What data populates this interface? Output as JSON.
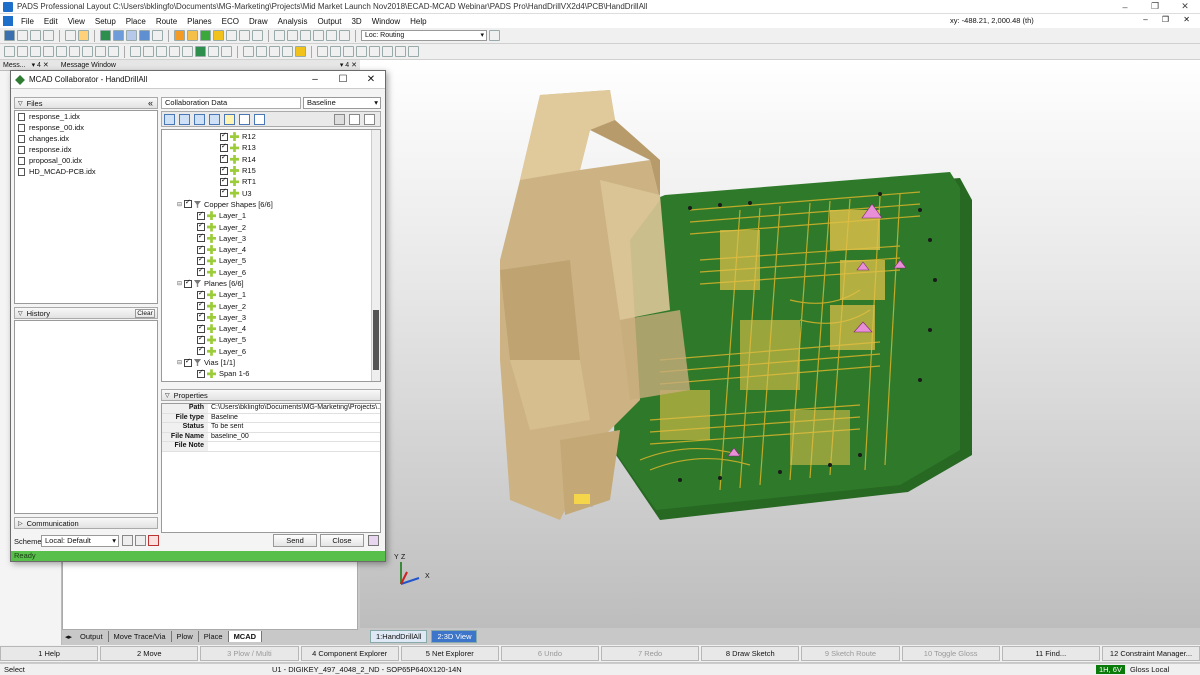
{
  "window": {
    "title": "PADS Professional Layout  C:\\Users\\bklingfo\\Documents\\MG-Marketing\\Projects\\Mid Market Launch Nov2018\\ECAD-MCAD Webinar\\PADS Pro\\HandDrillVX2d4\\PCB\\HandDrillAll",
    "minimize": "–",
    "maximize": "❐",
    "close": "✕"
  },
  "menu": {
    "items": [
      "File",
      "Edit",
      "View",
      "Setup",
      "Place",
      "Route",
      "Planes",
      "ECO",
      "Draw",
      "Analysis",
      "Output",
      "3D",
      "Window",
      "Help"
    ],
    "coords": "xy: -488.21, 2,000.48 (th)",
    "mdi_controls": "– ❐ ✕"
  },
  "toolbar": {
    "loc": "Loc: Routing"
  },
  "message_bar": {
    "left_tab": "Mess...",
    "pin": "▾ 4 ✕",
    "right_tab": "Message Window",
    "right_pin": "▾ 4 ✕"
  },
  "dialog": {
    "title": "MCAD Collaborator - HandDrillAll",
    "minimize": "–",
    "maximize": "☐",
    "close": "✕",
    "files": {
      "header": "Files",
      "collapse": "«",
      "items": [
        "response_1.idx",
        "response_00.idx",
        "changes.idx",
        "response.idx",
        "proposal_00.idx",
        "HD_MCAD-PCB.idx"
      ]
    },
    "history": {
      "header": "History",
      "clear": "Clear"
    },
    "communication": {
      "header": "Communication"
    },
    "collab": {
      "label": "Collaboration Data",
      "select": "Baseline"
    },
    "tree": {
      "refdes": [
        "R12",
        "R13",
        "R14",
        "R15",
        "RT1",
        "U3"
      ],
      "copper": {
        "label": "Copper Shapes [6/6]",
        "layers": [
          "Layer_1",
          "Layer_2",
          "Layer_3",
          "Layer_4",
          "Layer_5",
          "Layer_6"
        ]
      },
      "planes": {
        "label": "Planes [6/6]",
        "layers": [
          "Layer_1",
          "Layer_2",
          "Layer_3",
          "Layer_4",
          "Layer_5",
          "Layer_6"
        ]
      },
      "vias": {
        "label": "Vias [1/1]",
        "items": [
          "Span 1-6"
        ]
      }
    },
    "properties": {
      "header": "Properties",
      "rows": [
        {
          "key": "Path",
          "value": "C:\\Users\\bklingfo\\Documents\\MG-Marketing\\Projects\\..."
        },
        {
          "key": "File type",
          "value": "Baseline"
        },
        {
          "key": "Status",
          "value": "To be sent"
        },
        {
          "key": "File Name",
          "value": "baseline_00"
        },
        {
          "key": "File Note",
          "value": ""
        }
      ]
    },
    "scheme": {
      "label": "Scheme:",
      "value": "Local: Default"
    },
    "send": "Send",
    "close_btn": "Close",
    "status": "Ready"
  },
  "bottom_tabs": [
    "Output",
    "Move Trace/Via",
    "Plow",
    "Place",
    "MCAD"
  ],
  "view_tabs": [
    "1:HandDrillAll",
    "2:3D View"
  ],
  "axes": {
    "x": "X",
    "y": "Y",
    "z": "Z"
  },
  "function_keys": [
    {
      "label": "1 Help",
      "enabled": true
    },
    {
      "label": "2 Move",
      "enabled": true
    },
    {
      "label": "3 Plow / Multi",
      "enabled": false
    },
    {
      "label": "4 Component Explorer",
      "enabled": true
    },
    {
      "label": "5 Net Explorer",
      "enabled": true
    },
    {
      "label": "6 Undo",
      "enabled": false
    },
    {
      "label": "7 Redo",
      "enabled": false
    },
    {
      "label": "8 Draw Sketch",
      "enabled": true
    },
    {
      "label": "9 Sketch Route",
      "enabled": false
    },
    {
      "label": "10 Toggle Gloss",
      "enabled": false
    },
    {
      "label": "11 Find...",
      "enabled": true
    },
    {
      "label": "12 Constraint Manager...",
      "enabled": true
    }
  ],
  "status_bar": {
    "mode": "Select",
    "component": "U1 - DIGIKEY_497_4048_2_ND - SOP65P640X120-14N",
    "layer": "1H, 6V",
    "gloss": "Gloss Local"
  },
  "colors": {
    "board": "#2f7a2a",
    "housing": "#cdb384",
    "copper": "#d9b32a",
    "ready_bar": "#58c04a",
    "active_tab": "#3c75c9"
  }
}
